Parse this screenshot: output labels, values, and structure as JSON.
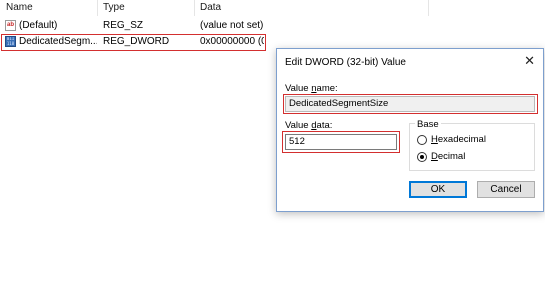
{
  "registry": {
    "columns": {
      "name": "Name",
      "type": "Type",
      "data": "Data"
    },
    "rows": [
      {
        "icon": "string-value-icon",
        "icon_text": "ab",
        "name": "(Default)",
        "type": "REG_SZ",
        "data": "(value not set)"
      },
      {
        "icon": "binary-value-icon",
        "name": "DedicatedSegm...",
        "type": "REG_DWORD",
        "data": "0x00000000 (0)"
      }
    ]
  },
  "dialog": {
    "title": "Edit DWORD (32-bit) Value",
    "close": "✕",
    "value_name_label": {
      "pre": "Value ",
      "key": "n",
      "post": "ame:"
    },
    "value_name": "DedicatedSegmentSize",
    "value_data_label": {
      "pre": "Value ",
      "key": "d",
      "post": "ata:"
    },
    "value_data": "512",
    "base": {
      "title": "Base",
      "hex": {
        "key": "H",
        "rest": "exadecimal",
        "selected": false
      },
      "dec": {
        "key": "D",
        "rest": "ecimal",
        "selected": true
      }
    },
    "ok_label": "OK",
    "cancel_label": "Cancel"
  },
  "colors": {
    "highlight": "#d32f2f",
    "accent": "#0078d7"
  }
}
